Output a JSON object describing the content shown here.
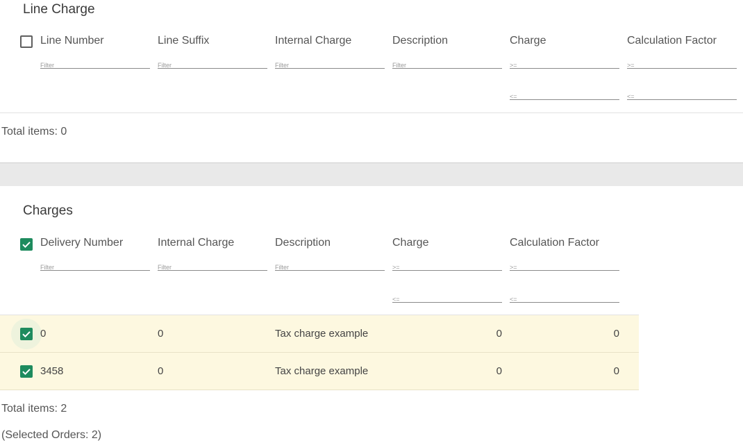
{
  "line_charge": {
    "title": "Line Charge",
    "columns": [
      {
        "label": "Line Number",
        "filters": [
          "Filter"
        ]
      },
      {
        "label": "Line Suffix",
        "filters": [
          "Filter"
        ]
      },
      {
        "label": "Internal Charge",
        "filters": [
          "Filter"
        ]
      },
      {
        "label": "Description",
        "filters": [
          "Filter"
        ]
      },
      {
        "label": "Charge",
        "filters": [
          ">=",
          "<="
        ]
      },
      {
        "label": "Calculation Factor",
        "filters": [
          ">=",
          "<="
        ]
      }
    ],
    "select_all_checked": false,
    "total_label": "Total items: 0"
  },
  "charges": {
    "title": "Charges",
    "columns": [
      {
        "label": "Delivery Number",
        "filters": [
          "Filter"
        ]
      },
      {
        "label": "Internal Charge",
        "filters": [
          "Filter"
        ]
      },
      {
        "label": "Description",
        "filters": [
          "Filter"
        ]
      },
      {
        "label": "Charge",
        "filters": [
          ">=",
          "<="
        ]
      },
      {
        "label": "Calculation Factor",
        "filters": [
          ">=",
          "<="
        ]
      }
    ],
    "select_all_checked": true,
    "rows": [
      {
        "checked": true,
        "delivery_number": "0",
        "internal_charge": "0",
        "description": "Tax charge example",
        "charge": "0",
        "calculation_factor": "0"
      },
      {
        "checked": true,
        "delivery_number": "3458",
        "internal_charge": "0",
        "description": "Tax charge example",
        "charge": "0",
        "calculation_factor": "0"
      }
    ],
    "total_label": "Total items: 2",
    "selected_label": "(Selected Orders: 2)"
  },
  "colors": {
    "accent": "#1e8b5e",
    "row_highlight": "#fdf8e0"
  }
}
